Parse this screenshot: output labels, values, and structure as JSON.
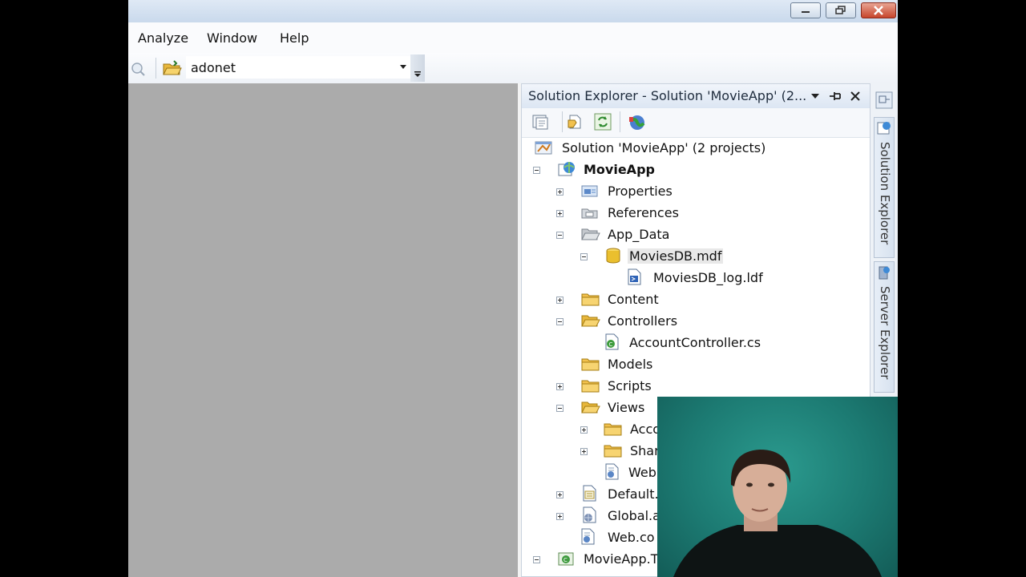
{
  "menu": {
    "items": [
      "Analyze",
      "Window",
      "Help"
    ]
  },
  "toolbar": {
    "config_combo_value": "adonet"
  },
  "solution_explorer": {
    "title": "Solution Explorer - Solution 'MovieApp' (2...",
    "tree": [
      {
        "label": "Solution 'MovieApp' (2 projects)",
        "icon": "solution-icon",
        "expander": "none",
        "bold": false
      },
      {
        "label": "MovieApp",
        "icon": "web-project-icon",
        "expander": "minus",
        "bold": true
      },
      {
        "label": "Properties",
        "icon": "properties-icon",
        "expander": "plus",
        "bold": false
      },
      {
        "label": "References",
        "icon": "references-icon",
        "expander": "plus",
        "bold": false
      },
      {
        "label": "App_Data",
        "icon": "folder-open-icon",
        "expander": "minus",
        "bold": false
      },
      {
        "label": "MoviesDB.mdf",
        "icon": "database-icon",
        "expander": "minus",
        "bold": false,
        "selected": true
      },
      {
        "label": "MoviesDB_log.ldf",
        "icon": "log-file-icon",
        "expander": "none",
        "bold": false
      },
      {
        "label": "Content",
        "icon": "folder-icon",
        "expander": "plus",
        "bold": false
      },
      {
        "label": "Controllers",
        "icon": "folder-open-icon",
        "expander": "minus",
        "bold": false
      },
      {
        "label": "AccountController.cs",
        "icon": "cs-file-icon",
        "expander": "none",
        "bold": false
      },
      {
        "label": "Models",
        "icon": "folder-icon",
        "expander": "none",
        "bold": false
      },
      {
        "label": "Scripts",
        "icon": "folder-icon",
        "expander": "plus",
        "bold": false
      },
      {
        "label": "Views",
        "icon": "folder-open-icon",
        "expander": "minus",
        "bold": false
      },
      {
        "label": "Acco",
        "icon": "folder-icon",
        "expander": "plus",
        "bold": false
      },
      {
        "label": "Shar",
        "icon": "folder-icon",
        "expander": "plus",
        "bold": false
      },
      {
        "label": "Web",
        "icon": "config-file-icon",
        "expander": "none",
        "bold": false
      },
      {
        "label": "Default.a",
        "icon": "aspx-file-icon",
        "expander": "plus",
        "bold": false
      },
      {
        "label": "Global.a",
        "icon": "global-asax-icon",
        "expander": "plus",
        "bold": false
      },
      {
        "label": "Web.co",
        "icon": "config-file-icon",
        "expander": "none",
        "bold": false
      },
      {
        "label": "MovieApp.T",
        "icon": "test-project-icon",
        "expander": "minus",
        "bold": false
      }
    ]
  },
  "side_tabs": [
    "Solution Explorer",
    "Server Explorer"
  ],
  "colors": {
    "editor_bg": "#ababab",
    "folder": "#f2c14e",
    "webcam_bg": "#1c7a72"
  }
}
